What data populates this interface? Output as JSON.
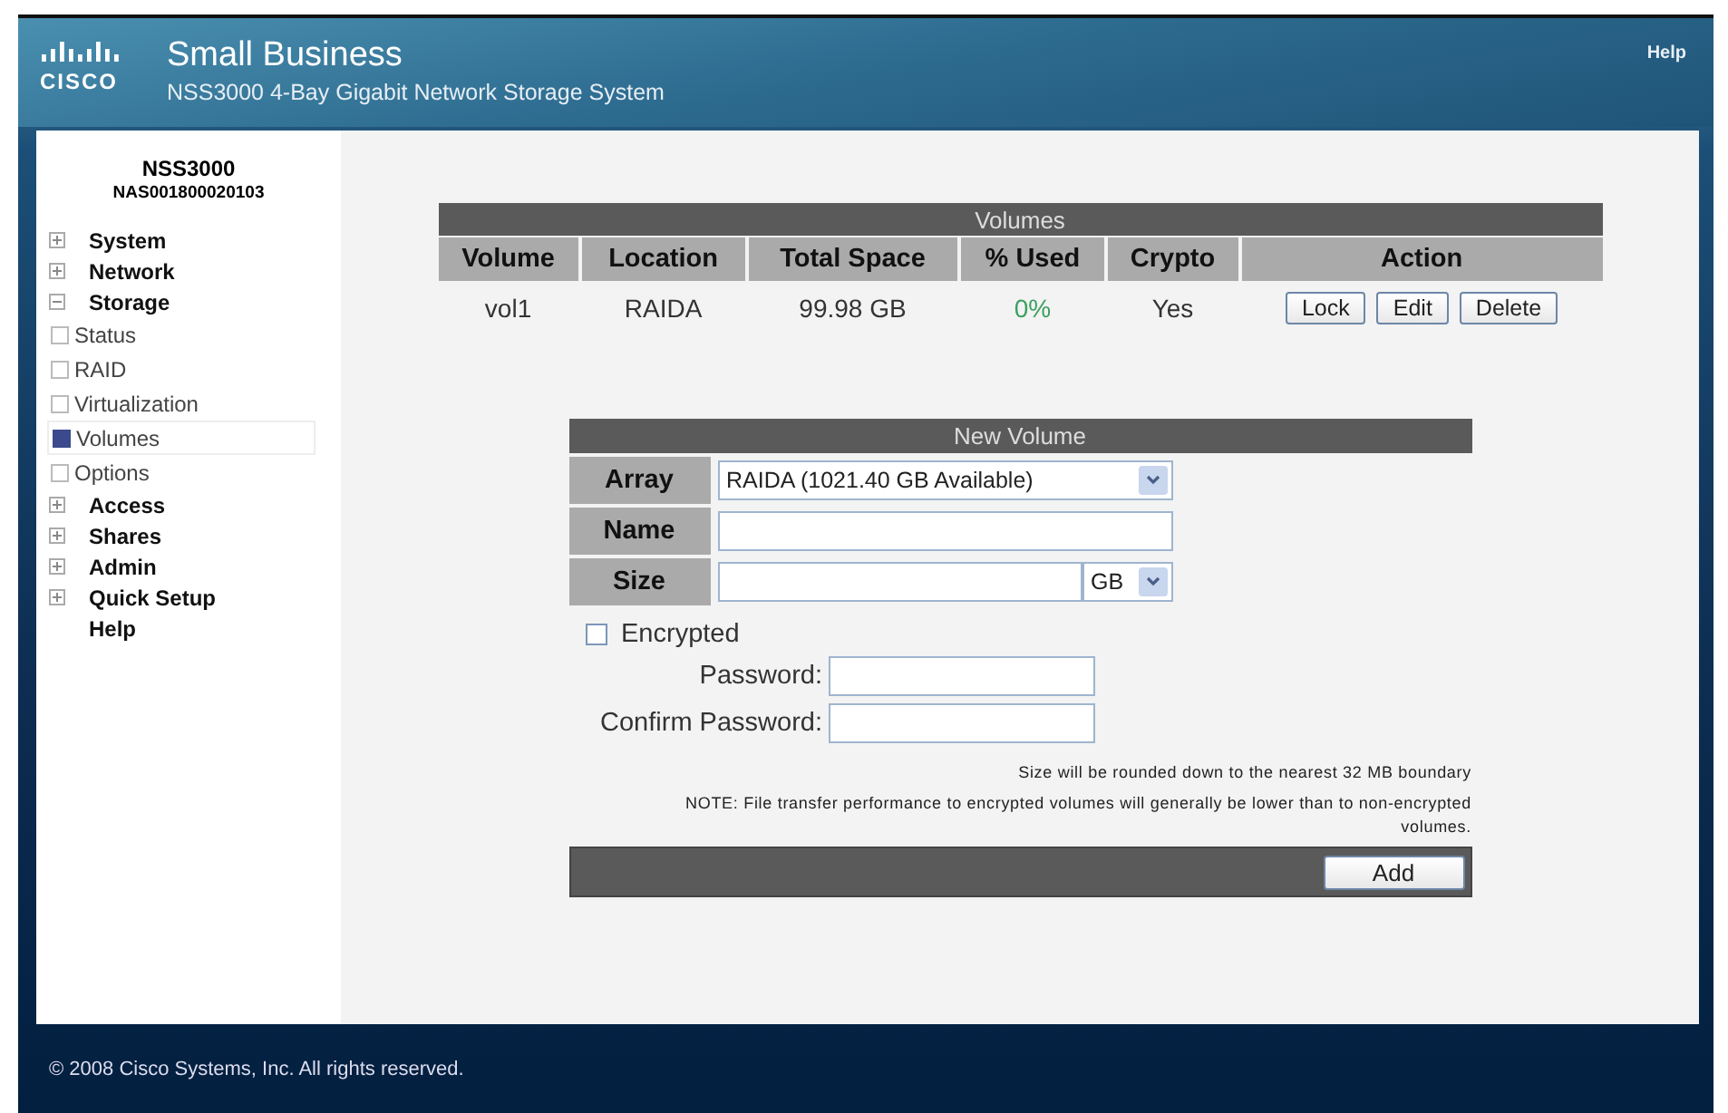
{
  "header": {
    "brand": "Small Business",
    "logo_word": "CISCO",
    "subtitle": "NSS3000 4-Bay Gigabit Network Storage System",
    "help": "Help"
  },
  "sidebar": {
    "device": "NSS3000",
    "serial": "NAS001800020103",
    "items": [
      {
        "kind": "group",
        "label": "System",
        "expanded": false
      },
      {
        "kind": "group",
        "label": "Network",
        "expanded": false
      },
      {
        "kind": "group",
        "label": "Storage",
        "expanded": true,
        "children": [
          {
            "label": "Status",
            "selected": false
          },
          {
            "label": "RAID",
            "selected": false
          },
          {
            "label": "Virtualization",
            "selected": false
          },
          {
            "label": "Volumes",
            "selected": true
          },
          {
            "label": "Options",
            "selected": false
          }
        ]
      },
      {
        "kind": "group",
        "label": "Access",
        "expanded": false
      },
      {
        "kind": "group",
        "label": "Shares",
        "expanded": false
      },
      {
        "kind": "group",
        "label": "Admin",
        "expanded": false
      },
      {
        "kind": "group",
        "label": "Quick Setup",
        "expanded": false
      },
      {
        "kind": "link",
        "label": "Help"
      }
    ]
  },
  "volumes": {
    "title": "Volumes",
    "columns": [
      "Volume",
      "Location",
      "Total Space",
      "% Used",
      "Crypto",
      "Action"
    ],
    "rows": [
      {
        "volume": "vol1",
        "location": "RAIDA",
        "total_space": "99.98 GB",
        "used": "0%",
        "crypto": "Yes",
        "actions": [
          "Lock",
          "Edit",
          "Delete"
        ]
      }
    ]
  },
  "new_volume": {
    "title": "New Volume",
    "array_label": "Array",
    "array_value": "RAIDA (1021.40 GB Available)",
    "name_label": "Name",
    "size_label": "Size",
    "size_unit": "GB",
    "encrypted": {
      "label": "Encrypted",
      "checked": false
    },
    "password_label": "Password:",
    "confirm_label": "Confirm Password:",
    "notes": [
      "Size will be rounded down to the nearest 32 MB boundary",
      "NOTE: File transfer performance to encrypted volumes will generally be lower than to non-encrypted volumes."
    ],
    "add_button": "Add"
  },
  "footer": "© 2008 Cisco Systems, Inc. All rights reserved."
}
